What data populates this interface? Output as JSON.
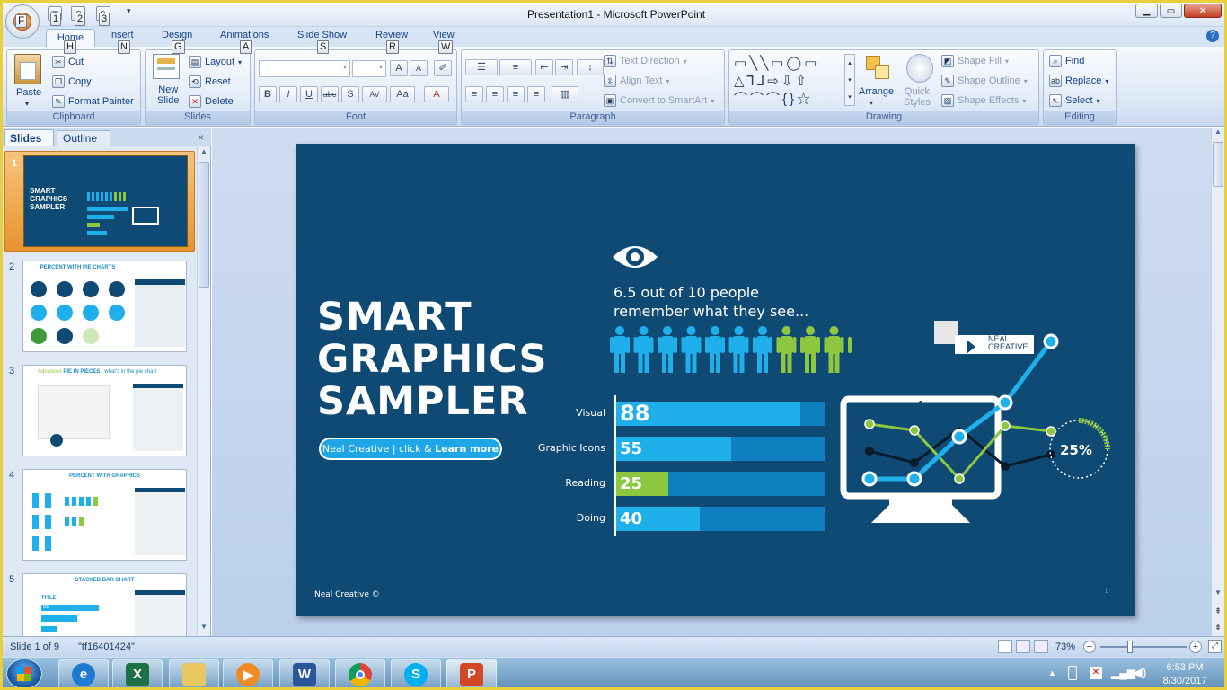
{
  "window": {
    "title": "Presentation1 - Microsoft PowerPoint",
    "office_button_letter": "F",
    "qat_keytips": [
      "1",
      "2",
      "3"
    ]
  },
  "tabs": [
    {
      "label": "Home",
      "key": "H"
    },
    {
      "label": "Insert",
      "key": "N"
    },
    {
      "label": "Design",
      "key": "G"
    },
    {
      "label": "Animations",
      "key": "A"
    },
    {
      "label": "Slide Show",
      "key": "S"
    },
    {
      "label": "Review",
      "key": "R"
    },
    {
      "label": "View",
      "key": "W"
    }
  ],
  "ribbon": {
    "clipboard": {
      "label": "Clipboard",
      "paste": "Paste",
      "cut": "Cut",
      "copy": "Copy",
      "format_painter": "Format Painter"
    },
    "slides": {
      "label": "Slides",
      "new_slide_1": "New",
      "new_slide_2": "Slide",
      "layout": "Layout",
      "reset": "Reset",
      "delete": "Delete"
    },
    "font": {
      "label": "Font"
    },
    "paragraph": {
      "label": "Paragraph",
      "text_direction": "Text Direction",
      "align_text": "Align Text",
      "convert": "Convert to SmartArt"
    },
    "drawing": {
      "label": "Drawing",
      "arrange": "Arrange",
      "quick_styles_1": "Quick",
      "quick_styles_2": "Styles",
      "shape_fill": "Shape Fill",
      "shape_outline": "Shape Outline",
      "shape_effects": "Shape Effects"
    },
    "editing": {
      "label": "Editing",
      "find": "Find",
      "replace": "Replace",
      "select": "Select"
    }
  },
  "left_pane": {
    "tab_slides": "Slides",
    "tab_outline": "Outline",
    "close": "×",
    "thumbs": [
      {
        "num": "1",
        "title_lines": [
          "SMART",
          "GRAPHICS",
          "SAMPLER"
        ]
      },
      {
        "num": "2",
        "title": "PERCENT WITH PIE CHARTS"
      },
      {
        "num": "3",
        "title_a": "Advanced",
        "title_b": "PIE IN PIECES",
        "title_c": "| what's in the pie chart"
      },
      {
        "num": "4",
        "title": "PERCENT WITH GRAPHICS"
      },
      {
        "num": "5",
        "title": "STACKED BAR CHART",
        "subtitle": "TITLE",
        "bar_value": "88"
      }
    ]
  },
  "slide": {
    "title_lines": [
      "SMART",
      "GRAPHICS",
      "SAMPLER"
    ],
    "button_a": "Neal Creative",
    "button_sep": " | click & ",
    "button_b": "Learn more",
    "tagline_1": "6.5 out of 10 people",
    "tagline_2": "remember what they see...",
    "people_blue": 7,
    "people_green": 4,
    "bars": [
      {
        "label": "Visual",
        "value": 88
      },
      {
        "label": "Graphic Icons",
        "value": 55
      },
      {
        "label": "Reading",
        "value": 25
      },
      {
        "label": "Doing",
        "value": 40
      }
    ],
    "logo_1": "NEAL",
    "logo_2": "CREATIVE",
    "percent": "25%",
    "footer": "Neal Creative ©",
    "page": "1",
    "colors": {
      "bg": "#0e4a74",
      "blue": "#1fb0ec",
      "green": "#8dc63f",
      "track": "#0f80bf"
    }
  },
  "status": {
    "slide_info": "Slide 1 of 9",
    "theme": "\"tf16401424\"",
    "zoom": "73%"
  },
  "taskbar": {
    "time": "6:53 PM",
    "date": "8/30/2017"
  }
}
